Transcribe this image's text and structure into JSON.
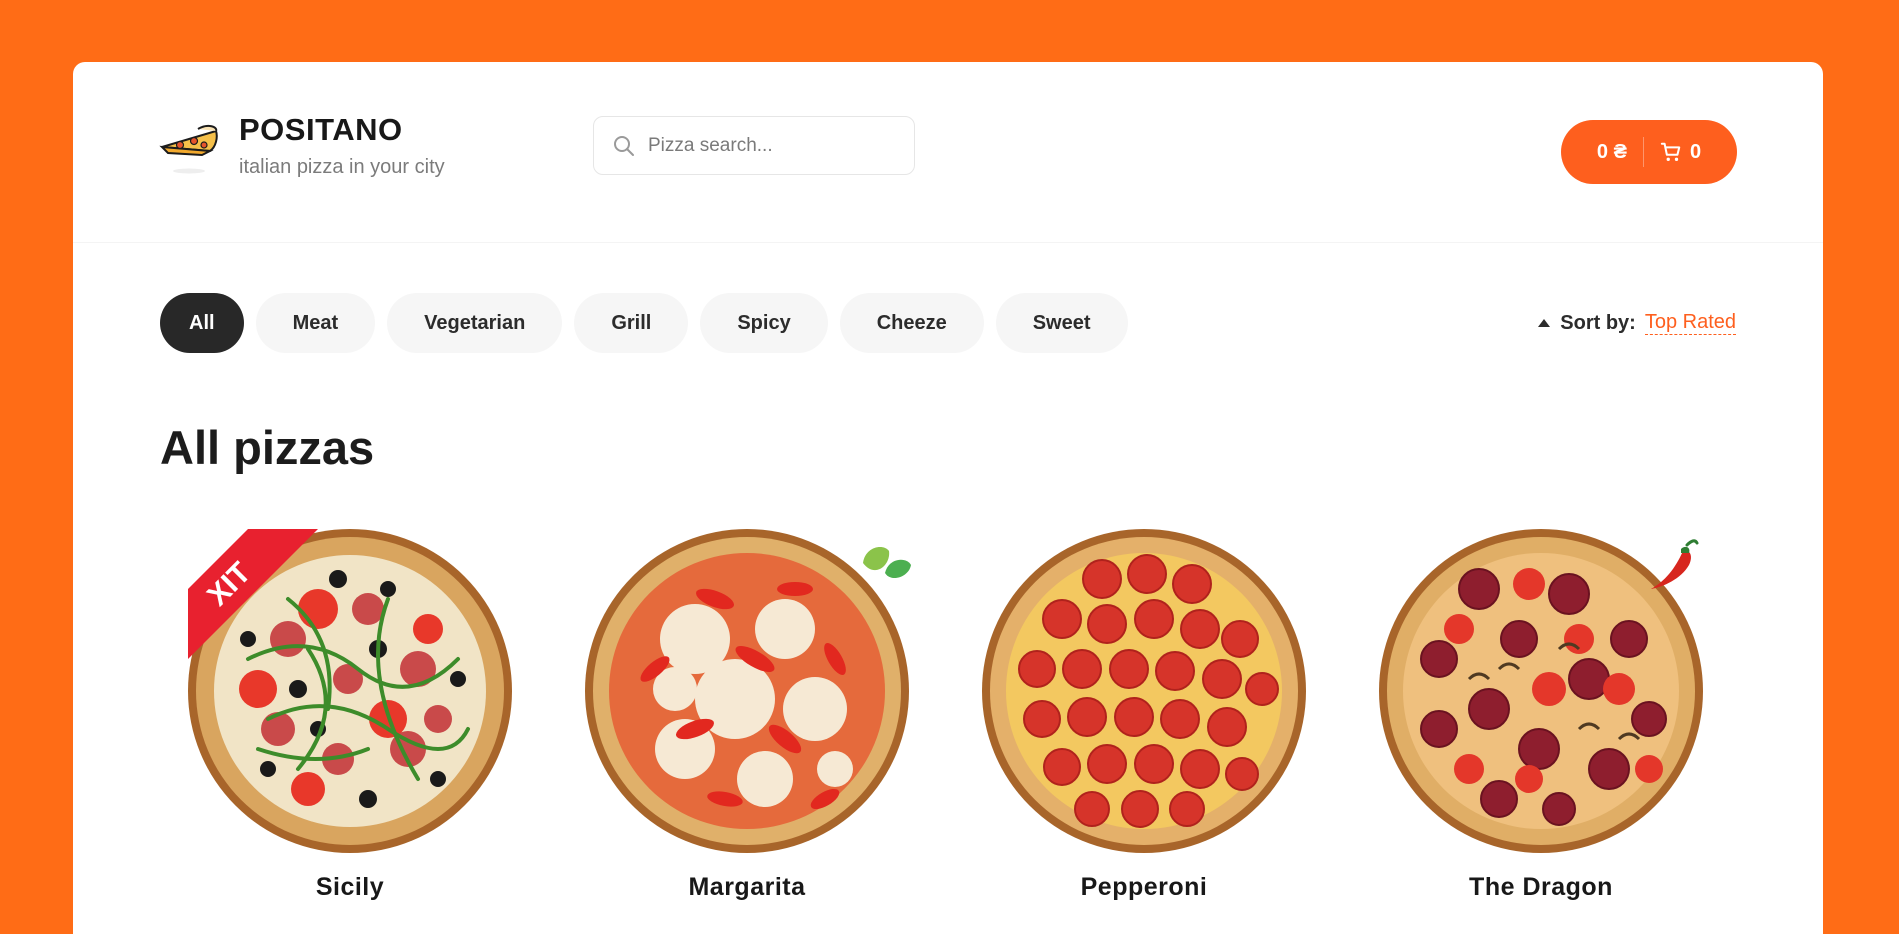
{
  "brand": {
    "title": "POSITANO",
    "subtitle": "italian pizza in your city"
  },
  "search": {
    "placeholder": "Pizza search...",
    "value": ""
  },
  "cart": {
    "total": "0 ₴",
    "count": "0"
  },
  "categories": [
    {
      "label": "All",
      "active": true
    },
    {
      "label": "Meat",
      "active": false
    },
    {
      "label": "Vegetarian",
      "active": false
    },
    {
      "label": "Grill",
      "active": false
    },
    {
      "label": "Spicy",
      "active": false
    },
    {
      "label": "Cheeze",
      "active": false
    },
    {
      "label": "Sweet",
      "active": false
    }
  ],
  "sort": {
    "label": "Sort by:",
    "value": "Top Rated"
  },
  "section_title": "All pizzas",
  "pizzas": [
    {
      "name": "Sicily",
      "badge": "ХІТ"
    },
    {
      "name": "Margarita",
      "badge_icon": "leaf-icon"
    },
    {
      "name": "Pepperoni"
    },
    {
      "name": "The Dragon",
      "badge_icon": "chili-pepper-icon"
    }
  ],
  "colors": {
    "accent": "#FE5F1E",
    "background": "#FF6C16",
    "active_category": "#282828"
  }
}
